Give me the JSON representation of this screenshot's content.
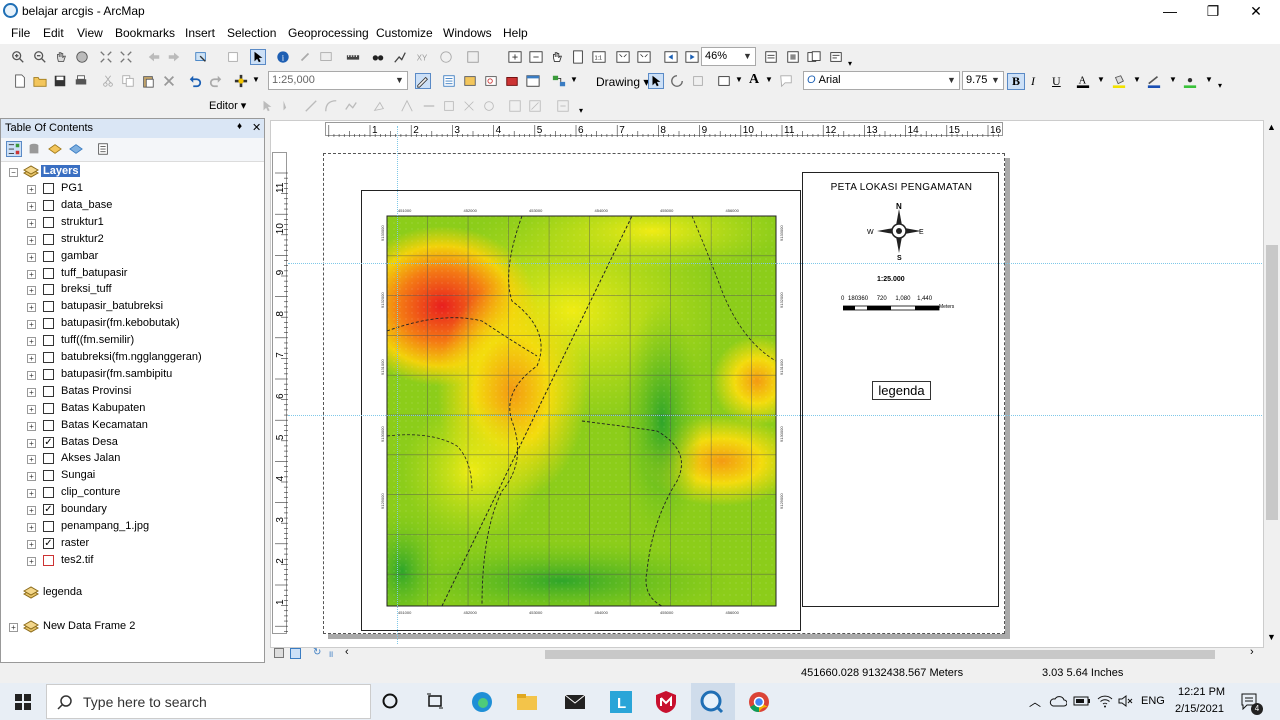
{
  "app": {
    "title": "belajar arcgis - ArcMap"
  },
  "window_controls": {
    "minimize": "—",
    "maximize": "❐",
    "close": "✕"
  },
  "menu": [
    "File",
    "Edit",
    "View",
    "Bookmarks",
    "Insert",
    "Selection",
    "Geoprocessing",
    "Customize",
    "Windows",
    "Help"
  ],
  "toolbar": {
    "zoom_value": "46%",
    "scale_value": "1:25,000",
    "drawing_label": "Drawing",
    "font_value": "Arial",
    "font_size": "9.75",
    "bold": "B",
    "italic": "I",
    "underline": "U",
    "editor_label": "Editor",
    "text_tool": "A"
  },
  "toc": {
    "title": "Table Of Contents",
    "pin": "♦",
    "close": "✕",
    "group": "Layers",
    "layers": [
      {
        "name": "PG1",
        "checked": false
      },
      {
        "name": "data_base",
        "checked": false
      },
      {
        "name": "struktur1",
        "checked": false
      },
      {
        "name": "struktur2",
        "checked": false
      },
      {
        "name": "gambar",
        "checked": false
      },
      {
        "name": "tuff_batupasir",
        "checked": false
      },
      {
        "name": "breksi_tuff",
        "checked": false
      },
      {
        "name": "batupasir_batubreksi",
        "checked": false
      },
      {
        "name": "batupasir(fm.kebobutak)",
        "checked": false
      },
      {
        "name": "tuff((fm.semilir)",
        "checked": false
      },
      {
        "name": "batubreksi(fm.ngglanggeran)",
        "checked": false
      },
      {
        "name": "batupasir(fm.sambipitu",
        "checked": false
      },
      {
        "name": "Batas Provinsi",
        "checked": false
      },
      {
        "name": "Batas Kabupaten",
        "checked": false
      },
      {
        "name": "Batas Kecamatan",
        "checked": false
      },
      {
        "name": "Batas Desa",
        "checked": true
      },
      {
        "name": "Akses Jalan",
        "checked": false
      },
      {
        "name": "Sungai",
        "checked": false
      },
      {
        "name": "clip_conture",
        "checked": false
      },
      {
        "name": "boundary",
        "checked": true
      },
      {
        "name": "penampang_1.jpg",
        "checked": false
      },
      {
        "name": "raster",
        "checked": true
      },
      {
        "name": "tes2.tif",
        "checked": false
      }
    ],
    "other_frames": [
      "legenda",
      "New Data Frame 2"
    ]
  },
  "ruler": {
    "h_ticks": [
      "1",
      "2",
      "3",
      "4",
      "5",
      "6",
      "7",
      "8",
      "9",
      "10",
      "11",
      "12",
      "13",
      "14",
      "15",
      "16"
    ],
    "v_ticks": [
      "11",
      "10",
      "9",
      "8",
      "7",
      "6",
      "5",
      "4",
      "3",
      "2",
      "1"
    ]
  },
  "map": {
    "title": "PETA LOKASI PENGAMATAN",
    "scale_text": "1:25.000",
    "north": "N",
    "south": "S",
    "west": "W",
    "east": "E",
    "scalebar_labels": [
      "0",
      "180360",
      "720",
      "1,080",
      "1,440"
    ],
    "scalebar_unit": "Meters",
    "legend_box": "legenda",
    "top_coords": [
      "451000",
      "452000",
      "453000",
      "454000",
      "455000",
      "456000"
    ],
    "bottom_coords": [
      "451000",
      "452000",
      "453000",
      "454000",
      "455000",
      "456000"
    ],
    "left_coords": [
      "9133000",
      "9132000",
      "9131000",
      "9130000",
      "9129000"
    ],
    "right_coords": [
      "9133000",
      "9132000",
      "9131000",
      "9130000",
      "9129000"
    ]
  },
  "status": {
    "coords": "451660.028  9132438.567 Meters",
    "page_pos": "3.03  5.64 Inches"
  },
  "taskbar": {
    "search_placeholder": "Type here to search",
    "time": "12:21 PM",
    "date": "2/15/2021",
    "lang": "ENG",
    "notif_count": "4"
  }
}
